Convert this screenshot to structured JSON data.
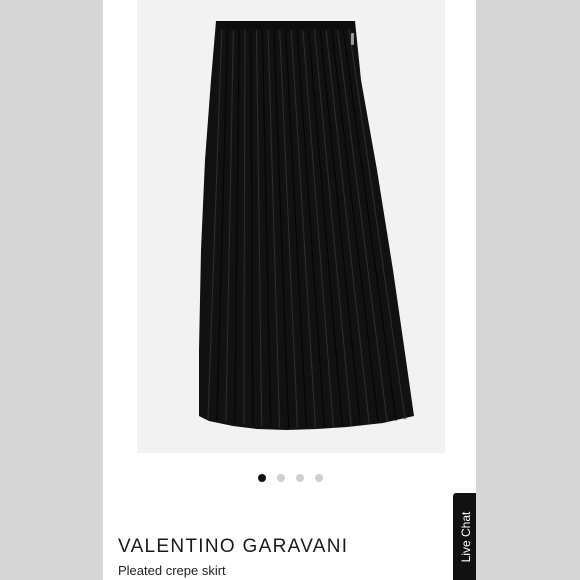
{
  "product": {
    "brand": "VALENTINO GARAVANI",
    "name": "Pleated crepe skirt",
    "image_alt": "Black pleated crepe midi skirt"
  },
  "carousel": {
    "total": 4,
    "active_index": 0
  },
  "live_chat": {
    "label": "Live Chat"
  },
  "colors": {
    "page_background": "#d9d9d9",
    "image_background": "#f2f2f2",
    "skirt": "#111111",
    "dot_active": "#111111",
    "dot_inactive": "#cfcfcf",
    "chat_background": "#111111"
  }
}
